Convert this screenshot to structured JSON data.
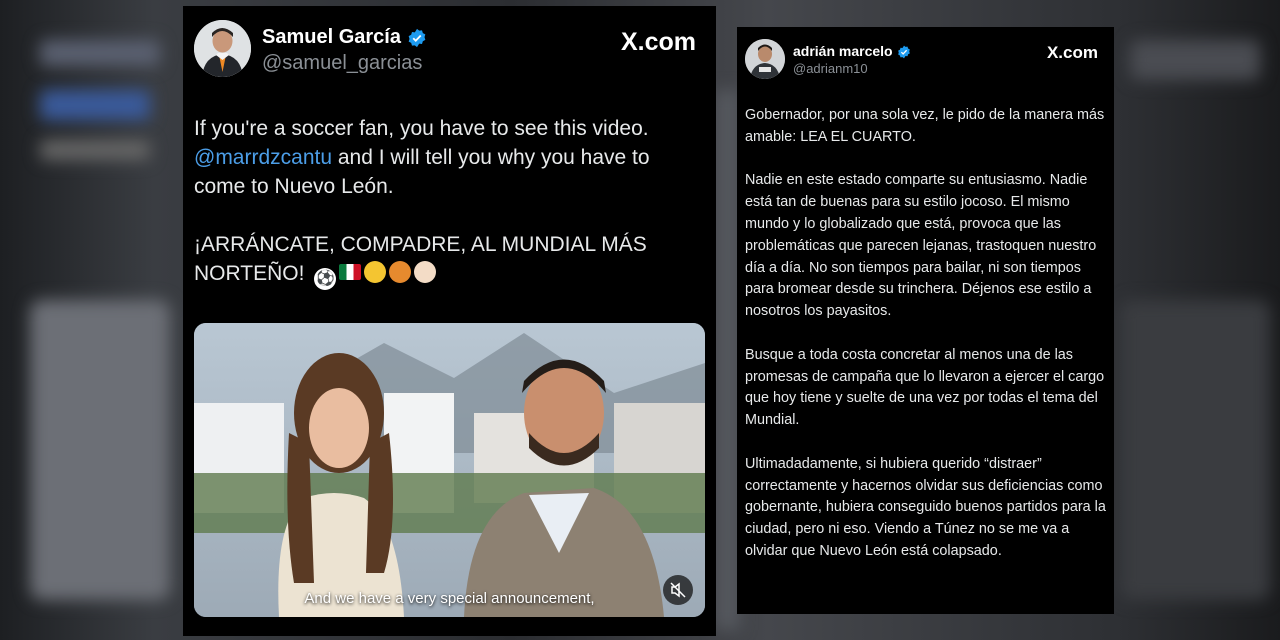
{
  "tweet_left": {
    "author_name": "Samuel García",
    "author_handle": "@samuel_garcias",
    "site": "X.com",
    "text_line1": "If you're a soccer fan, you have to see this video.",
    "mention": "@marrdzcantu",
    "text_line2": " and I will tell you why you have to come to Nuevo León.",
    "text_line3": "¡ARRÁNCATE, COMPADRE, AL MUNDIAL MÁS NORTEÑO!",
    "emojis": [
      "⚽",
      "🇲🇽",
      "🤠",
      "🦁",
      "👊"
    ],
    "video_subtitle": "And we have a very special announcement,"
  },
  "tweet_right": {
    "author_name": "adrián marcelo",
    "author_handle": "@adrianm10",
    "site": "X.com",
    "paragraphs": [
      "Gobernador, por una sola vez, le pido de la manera más amable: LEA EL CUARTO.",
      "Nadie en este estado comparte su entusiasmo. Nadie está tan de buenas para su estilo jocoso. El mismo mundo y lo globalizado que está, provoca que las problemáticas que parecen lejanas, trastoquen nuestro día a día. No son tiempos para bailar, ni son tiempos para bromear desde su trinchera. Déjenos ese estilo a nosotros los payasitos.",
      "Busque a toda costa concretar al menos una de las promesas de campaña que lo llevaron a ejercer el cargo que hoy tiene y suelte de una vez por todas el tema del Mundial.",
      "Ultimadadamente, si hubiera querido “distraer” correctamente y hacernos olvidar sus deficiencias como gobernante, hubiera conseguido buenos partidos para la ciudad, pero ni eso. Viendo a Túnez no se me va a olvidar que Nuevo León está colapsado."
    ]
  },
  "colors": {
    "mention": "#4c9ee8",
    "verified": "#1d9bf0",
    "tweet_bg": "#000000"
  }
}
